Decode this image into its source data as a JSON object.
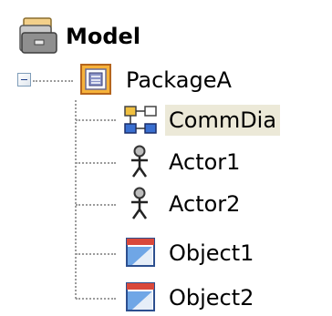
{
  "tree": {
    "root": {
      "label": "Model",
      "icon": "model-folder-icon"
    },
    "package": {
      "label": "PackageA",
      "icon": "package-icon",
      "expanded": true
    },
    "children": [
      {
        "label": "CommDia",
        "icon": "communication-diagram-icon",
        "selected": true
      },
      {
        "label": "Actor1",
        "icon": "actor-icon"
      },
      {
        "label": "Actor2",
        "icon": "actor-icon"
      },
      {
        "label": "Object1",
        "icon": "object-icon"
      },
      {
        "label": "Object2",
        "icon": "object-icon"
      }
    ]
  }
}
